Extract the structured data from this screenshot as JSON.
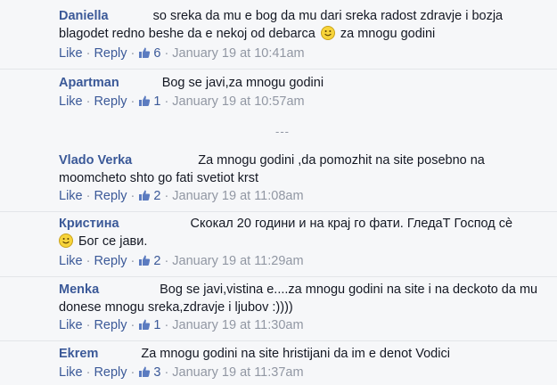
{
  "comments": [
    {
      "name": "Daniella",
      "text_a": "so sreka da mu e bog da mu dari sreka radost zdravje i bozja blagodet redno beshe da e nekoj od debarca",
      "text_b": "za mnogu godini",
      "has_smiley": true,
      "like": "Like",
      "reply": "Reply",
      "likes": "6",
      "time": "January 19 at 10:41am"
    },
    {
      "name": "Apartman",
      "text_a": "Bog se javi,za mnogu godini",
      "like": "Like",
      "reply": "Reply",
      "likes": "1",
      "time": "January 19 at 10:57am"
    },
    {
      "name": "Vlado Verka",
      "text_a": "Za mnogu godini ,da pomozhit na site posebno na moomcheto shto go fati svetiot krst",
      "like": "Like",
      "reply": "Reply",
      "likes": "2",
      "time": "January 19 at 11:08am"
    },
    {
      "name": "Кристина",
      "text_a": "Скокал 20 години и на крај го фати. ГледаТ Господ сè",
      "text_b": "Бог се јави.",
      "has_smiley": true,
      "like": "Like",
      "reply": "Reply",
      "likes": "2",
      "time": "January 19 at 11:29am"
    },
    {
      "name": "Menka",
      "text_a": "Bog se javi,vistina e....za mnogu godini na site i na deckoto da mu donese mnogu sreka,zdravje i ljubov :))))",
      "like": "Like",
      "reply": "Reply",
      "likes": "1",
      "time": "January 19 at 11:30am"
    },
    {
      "name": "Ekrem",
      "text_a": "Za mnogu godini na site hristijani da im e denot Vodici",
      "like": "Like",
      "reply": "Reply",
      "likes": "3",
      "time": "January 19 at 11:37am"
    }
  ],
  "more_marker": "---",
  "separator": "·",
  "icons": {
    "like": "thumbs-up-icon",
    "smiley": "smiley-icon"
  },
  "colors": {
    "link": "#3b5998",
    "meta": "#9197a3",
    "text": "#141823",
    "background": "#f6f7f9"
  }
}
